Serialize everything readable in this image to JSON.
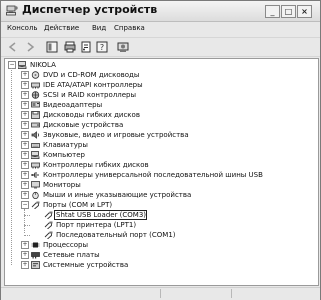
{
  "window": {
    "title": "Диспетчер устройств"
  },
  "titlebar_buttons": {
    "minimize": "_",
    "maximize": "□",
    "close": "×"
  },
  "menu": [
    "Консоль",
    "Действие",
    "Вид",
    "Справка"
  ],
  "tree": [
    {
      "label": "NIKOLA",
      "depth": 0,
      "expander": "−",
      "icon": "computer-icon"
    },
    {
      "label": "DVD и CD-ROM дисководы",
      "depth": 1,
      "expander": "+",
      "icon": "cdrom-icon"
    },
    {
      "label": "IDE ATA/ATAPI контроллеры",
      "depth": 1,
      "expander": "+",
      "icon": "controller-icon"
    },
    {
      "label": "SCSI и RAID контроллеры",
      "depth": 1,
      "expander": "+",
      "icon": "scsi-icon"
    },
    {
      "label": "Видеоадаптеры",
      "depth": 1,
      "expander": "+",
      "icon": "display-adapter-icon"
    },
    {
      "label": "Дисководы гибких дисков",
      "depth": 1,
      "expander": "+",
      "icon": "floppy-icon"
    },
    {
      "label": "Дисковые устройства",
      "depth": 1,
      "expander": "+",
      "icon": "disk-icon"
    },
    {
      "label": "Звуковые, видео и игровые устройства",
      "depth": 1,
      "expander": "+",
      "icon": "sound-icon"
    },
    {
      "label": "Клавиатуры",
      "depth": 1,
      "expander": "+",
      "icon": "keyboard-icon"
    },
    {
      "label": "Компьютер",
      "depth": 1,
      "expander": "+",
      "icon": "computer-icon"
    },
    {
      "label": "Контроллеры гибких дисков",
      "depth": 1,
      "expander": "+",
      "icon": "controller-icon"
    },
    {
      "label": "Контроллеры универсальной последовательной шины USB",
      "depth": 1,
      "expander": "+",
      "icon": "usb-icon"
    },
    {
      "label": "Мониторы",
      "depth": 1,
      "expander": "+",
      "icon": "monitor-icon"
    },
    {
      "label": "Мыши и иные указывающие устройства",
      "depth": 1,
      "expander": "+",
      "icon": "mouse-icon"
    },
    {
      "label": "Порты (COM и LPT)",
      "depth": 1,
      "expander": "−",
      "icon": "port-icon"
    },
    {
      "label": "Shtat USB Loader (COM3)",
      "depth": 2,
      "expander": "",
      "icon": "port-icon",
      "selected": true
    },
    {
      "label": "Порт принтера (LPT1)",
      "depth": 2,
      "expander": "",
      "icon": "port-icon"
    },
    {
      "label": "Последовательный порт (COM1)",
      "depth": 2,
      "expander": "",
      "icon": "port-icon"
    },
    {
      "label": "Процессоры",
      "depth": 1,
      "expander": "+",
      "icon": "processor-icon"
    },
    {
      "label": "Сетевые платы",
      "depth": 1,
      "expander": "+",
      "icon": "network-icon"
    },
    {
      "label": "Системные устройства",
      "depth": 1,
      "expander": "+",
      "icon": "system-icon"
    }
  ]
}
